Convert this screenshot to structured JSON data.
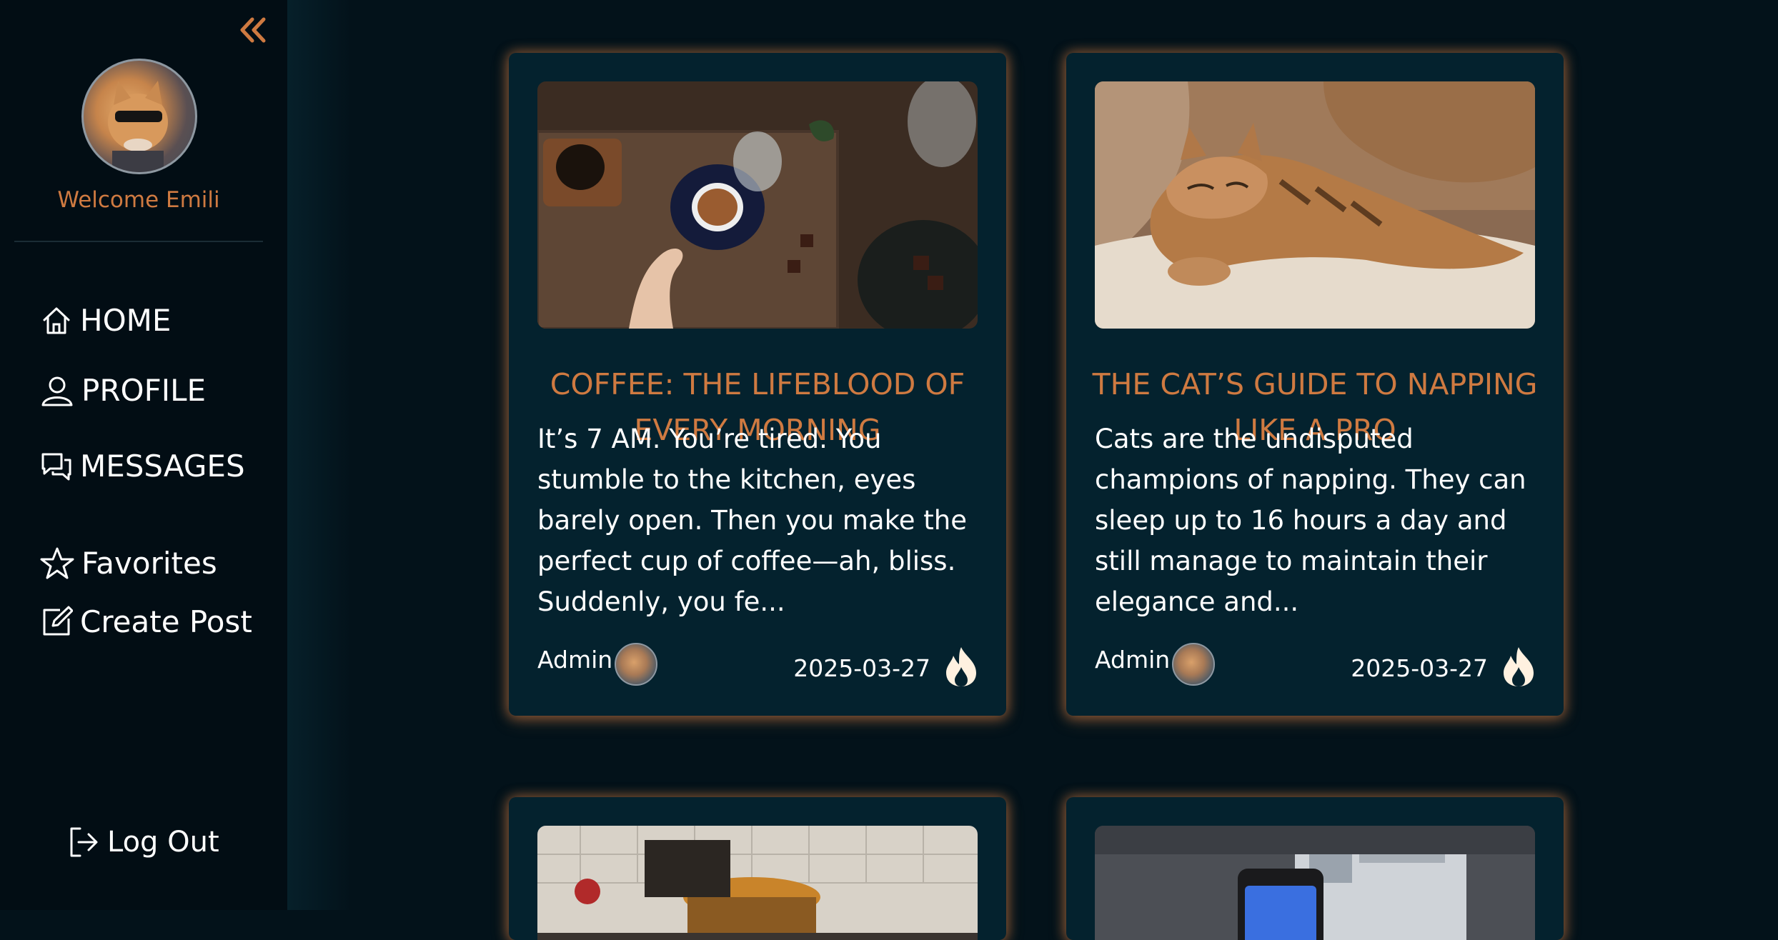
{
  "sidebar": {
    "welcome": "Welcome Emili",
    "nav": [
      {
        "label": "HOME",
        "icon": "house-icon"
      },
      {
        "label": "PROFILE",
        "icon": "user-icon"
      },
      {
        "label": "MESSAGES",
        "icon": "chat-icon"
      },
      {
        "label": "Favorites",
        "icon": "star-icon"
      },
      {
        "label": "Create Post",
        "icon": "edit-icon"
      }
    ],
    "logout": "Log Out",
    "collapse_icon": "double-chevron-left-icon"
  },
  "posts": [
    {
      "title": "COFFEE: THE LIFEBLOOD OF EVERY MORNING",
      "excerpt": "It’s 7 AM. You’re tired. You stumble to the kitchen, eyes barely open. Then you make the perfect cup of coffee—ah, bliss. Suddenly, you fe...",
      "author": "Admin",
      "date": "2025-03-27",
      "image": "coffee-table-photo"
    },
    {
      "title": "THE CAT’S GUIDE TO NAPPING LIKE A PRO",
      "excerpt": "Cats are the undisputed champions of napping. They can sleep up to 16 hours a day and still manage to maintain their elegance and...",
      "author": "Admin",
      "date": "2025-03-27",
      "image": "sleeping-cat-photo"
    },
    {
      "image": "cooking-pot-photo"
    },
    {
      "image": "phone-desk-photo"
    }
  ],
  "colors": {
    "accent": "#cf7a41",
    "background": "#03121a",
    "sidebar": "#020d14",
    "card": "#04222e",
    "text": "#ffffff"
  }
}
